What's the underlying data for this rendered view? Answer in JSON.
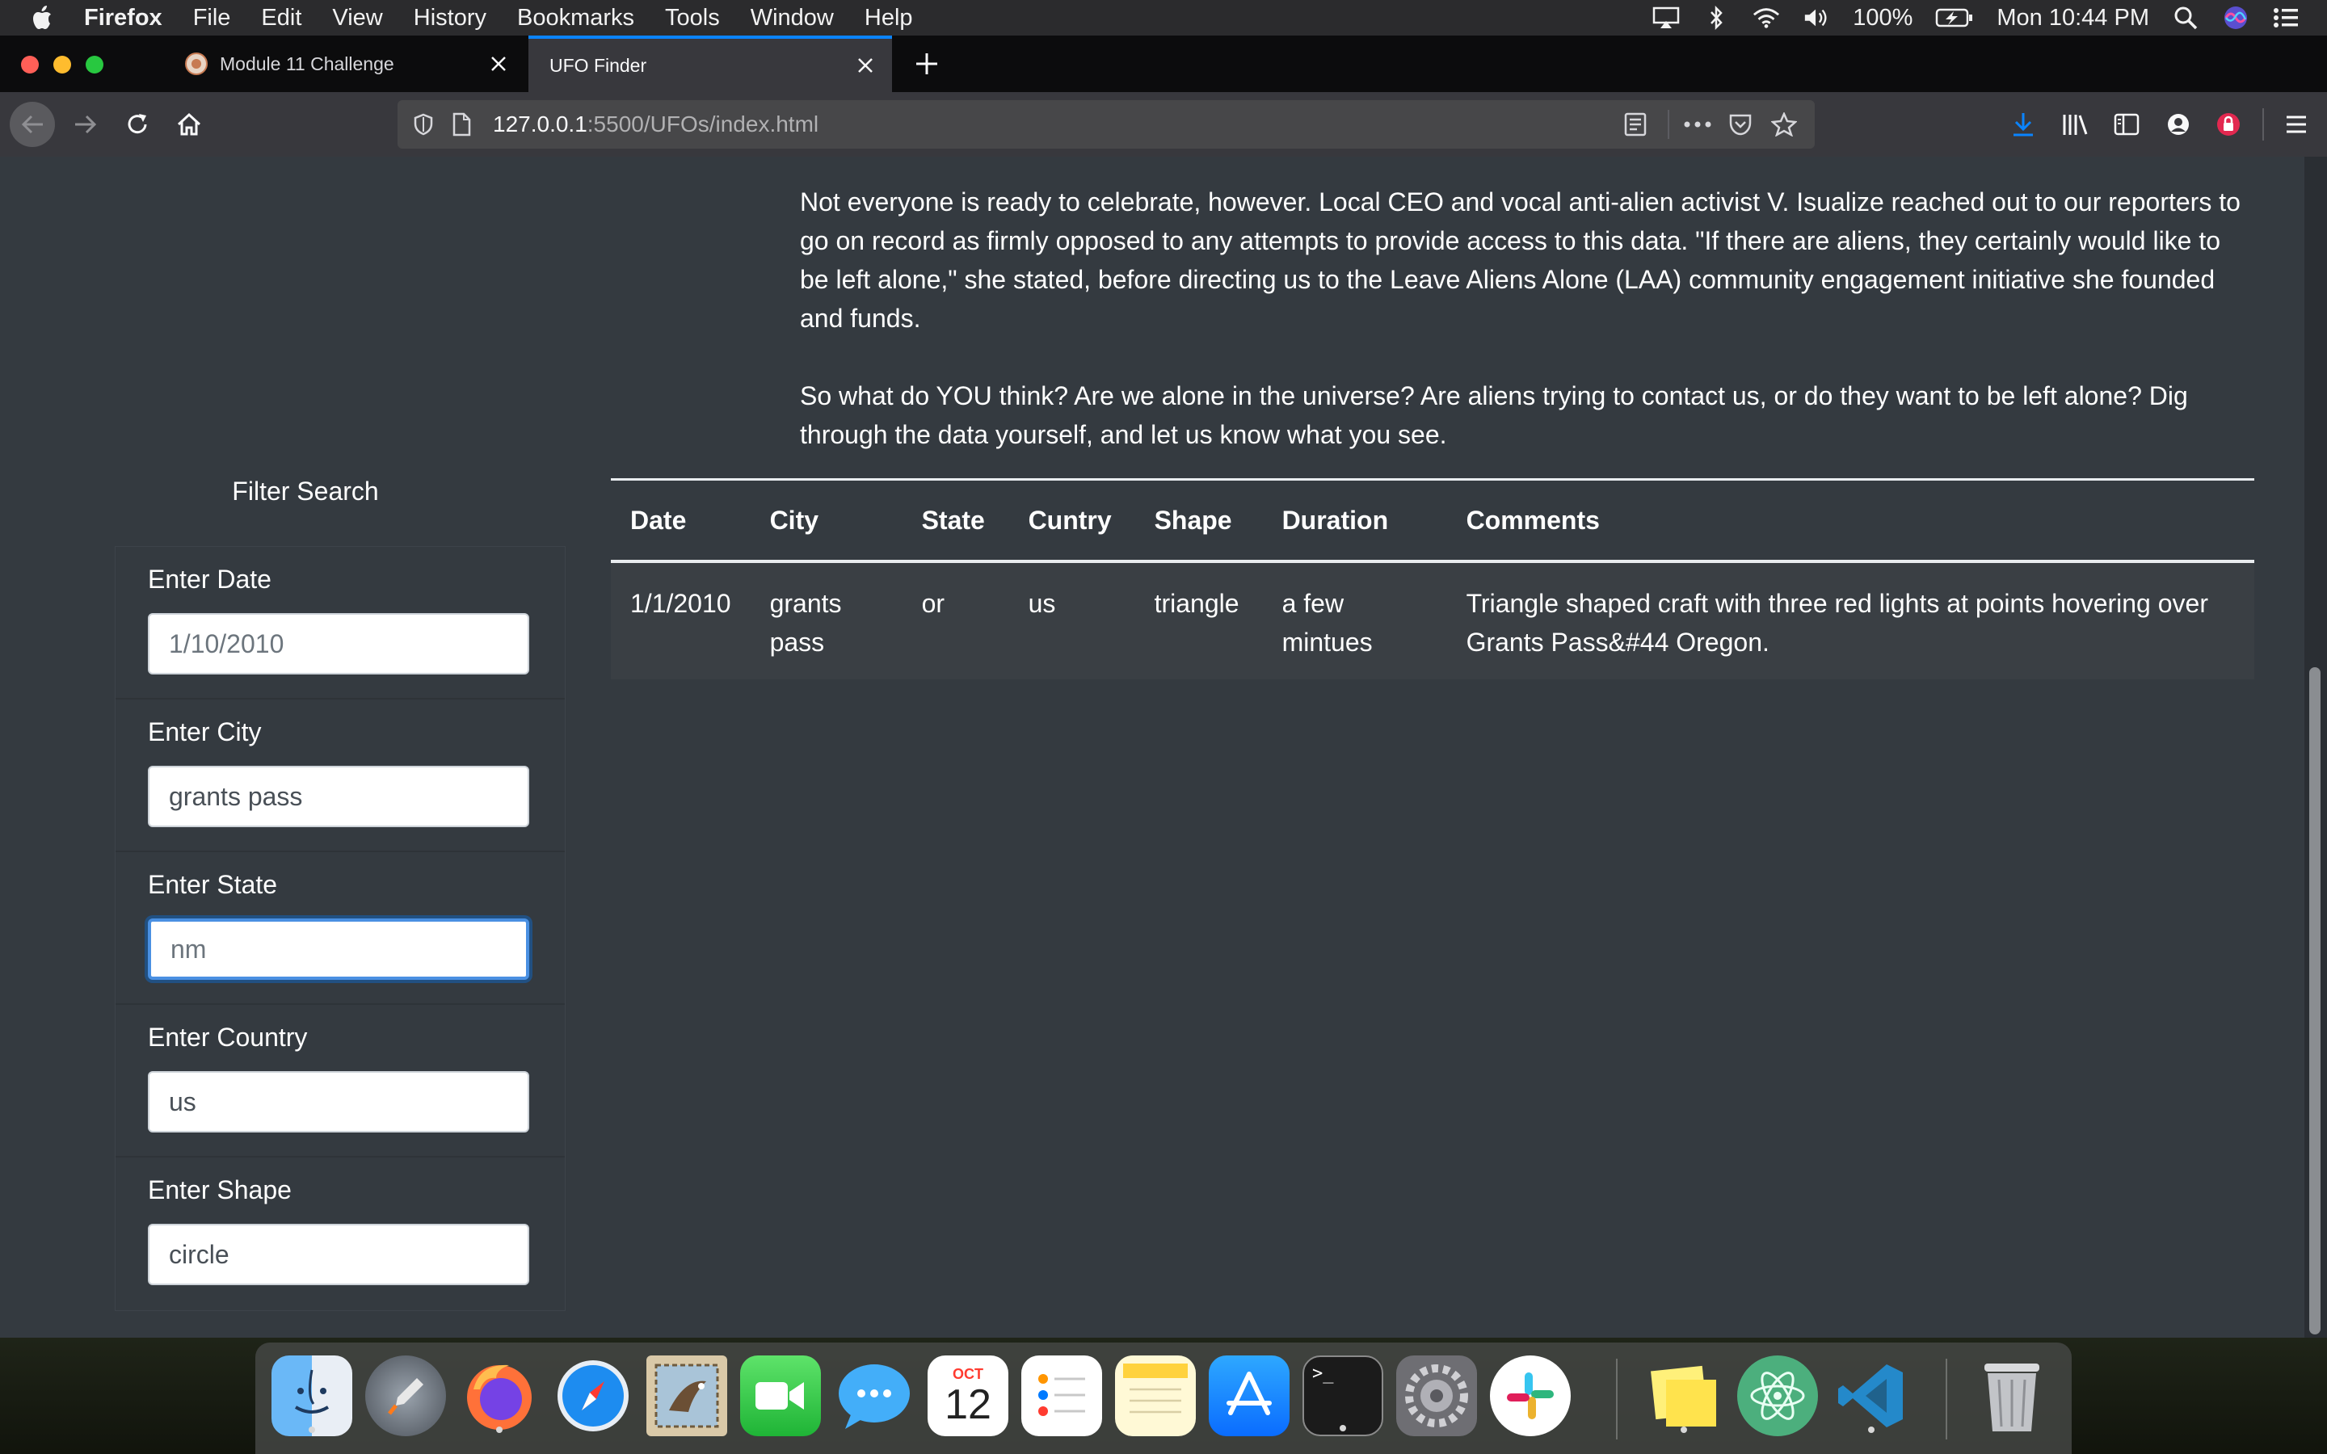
{
  "menubar": {
    "app_name": "Firefox",
    "items": [
      "File",
      "Edit",
      "View",
      "History",
      "Bookmarks",
      "Tools",
      "Window",
      "Help"
    ],
    "battery": "100%",
    "clock": "Mon 10:44 PM"
  },
  "browser": {
    "tabs": [
      {
        "title": "Module 11 Challenge",
        "active": false
      },
      {
        "title": "UFO Finder",
        "active": true
      }
    ],
    "url_host": "127.0.0.1",
    "url_path": ":5500/UFOs/index.html",
    "accent": "#0a84ff"
  },
  "article": {
    "paragraphs": [
      "Not everyone is ready to celebrate, however. Local CEO and vocal anti-alien activist V. Isualize reached out to our reporters to go on record as firmly opposed to any attempts to provide access to this data. \"If there are aliens, they certainly would like to be left alone,\" she stated, before directing us to the Leave Aliens Alone (LAA) community engagement initiative she founded and funds.",
      "So what do YOU think? Are we alone in the universe? Are aliens trying to contact us, or do they want to be left alone? Dig through the data yourself, and let us know what you see."
    ]
  },
  "filters": {
    "title": "Filter Search",
    "items": [
      {
        "label": "Enter Date",
        "placeholder": "1/10/2010",
        "value": ""
      },
      {
        "label": "Enter City",
        "placeholder": "",
        "value": "grants pass"
      },
      {
        "label": "Enter State",
        "placeholder": "nm",
        "value": ""
      },
      {
        "label": "Enter Country",
        "placeholder": "",
        "value": "us"
      },
      {
        "label": "Enter Shape",
        "placeholder": "",
        "value": "circle"
      }
    ]
  },
  "table": {
    "headers": [
      "Date",
      "City",
      "State",
      "Cuntry",
      "Shape",
      "Duration",
      "Comments"
    ],
    "rows": [
      [
        "1/1/2010",
        "grants pass",
        "or",
        "us",
        "triangle",
        "a few mintues",
        "Triangle shaped craft with three red lights at points hovering over Grants Pass&#44 Oregon."
      ]
    ]
  },
  "dock": {
    "apps": [
      "finder-icon",
      "launchpad-icon",
      "firefox-icon",
      "safari-icon",
      "mail-icon",
      "facetime-icon",
      "messages-icon",
      "calendar-icon",
      "reminders-icon",
      "notes-icon",
      "app-store-icon",
      "terminal-icon",
      "system-preferences-icon",
      "slack-icon",
      "stickies-icon",
      "atom-icon",
      "vscode-icon",
      "trash-icon"
    ],
    "calendar_month": "OCT",
    "calendar_day": "12",
    "terminal_prompt": ">_"
  }
}
